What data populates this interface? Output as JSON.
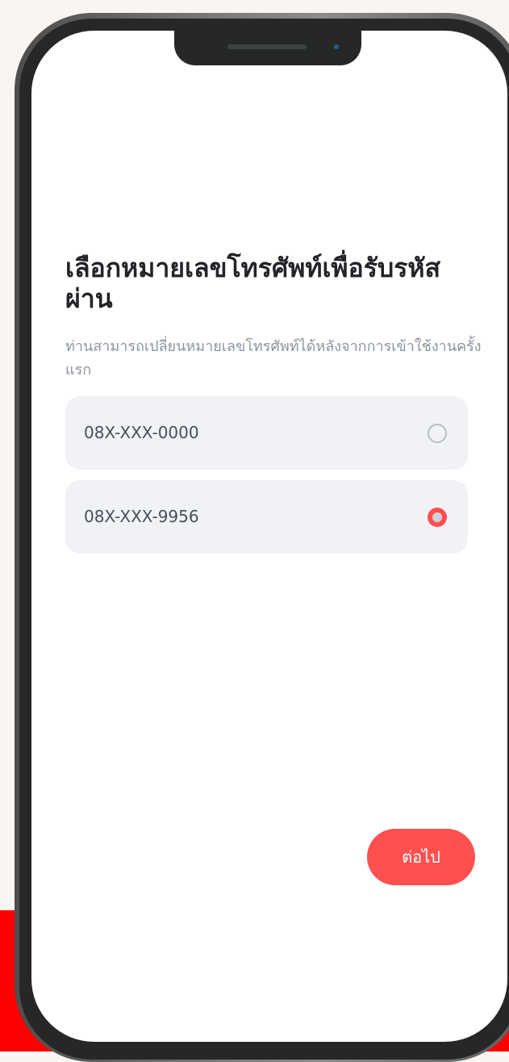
{
  "screen": {
    "title": "เลือกหมายเลขโทรศัพท์เพื่อรับรหัสผ่าน",
    "subtitle": "ท่านสามารถเปลี่ยนหมายเลขโทรศัพท์ได้หลังจากการเข้าใช้งานครั้งแรก"
  },
  "options": [
    {
      "label": "08X-XXX-0000",
      "selected": false
    },
    {
      "label": "08X-XXX-9956",
      "selected": true
    }
  ],
  "actions": {
    "next_label": "ต่อไป"
  },
  "colors": {
    "accent": "#ff4f4f",
    "background_band": "#ff0000",
    "option_background": "#f1f2f6",
    "title_text": "#232428",
    "subtitle_text": "#8d93a1"
  }
}
